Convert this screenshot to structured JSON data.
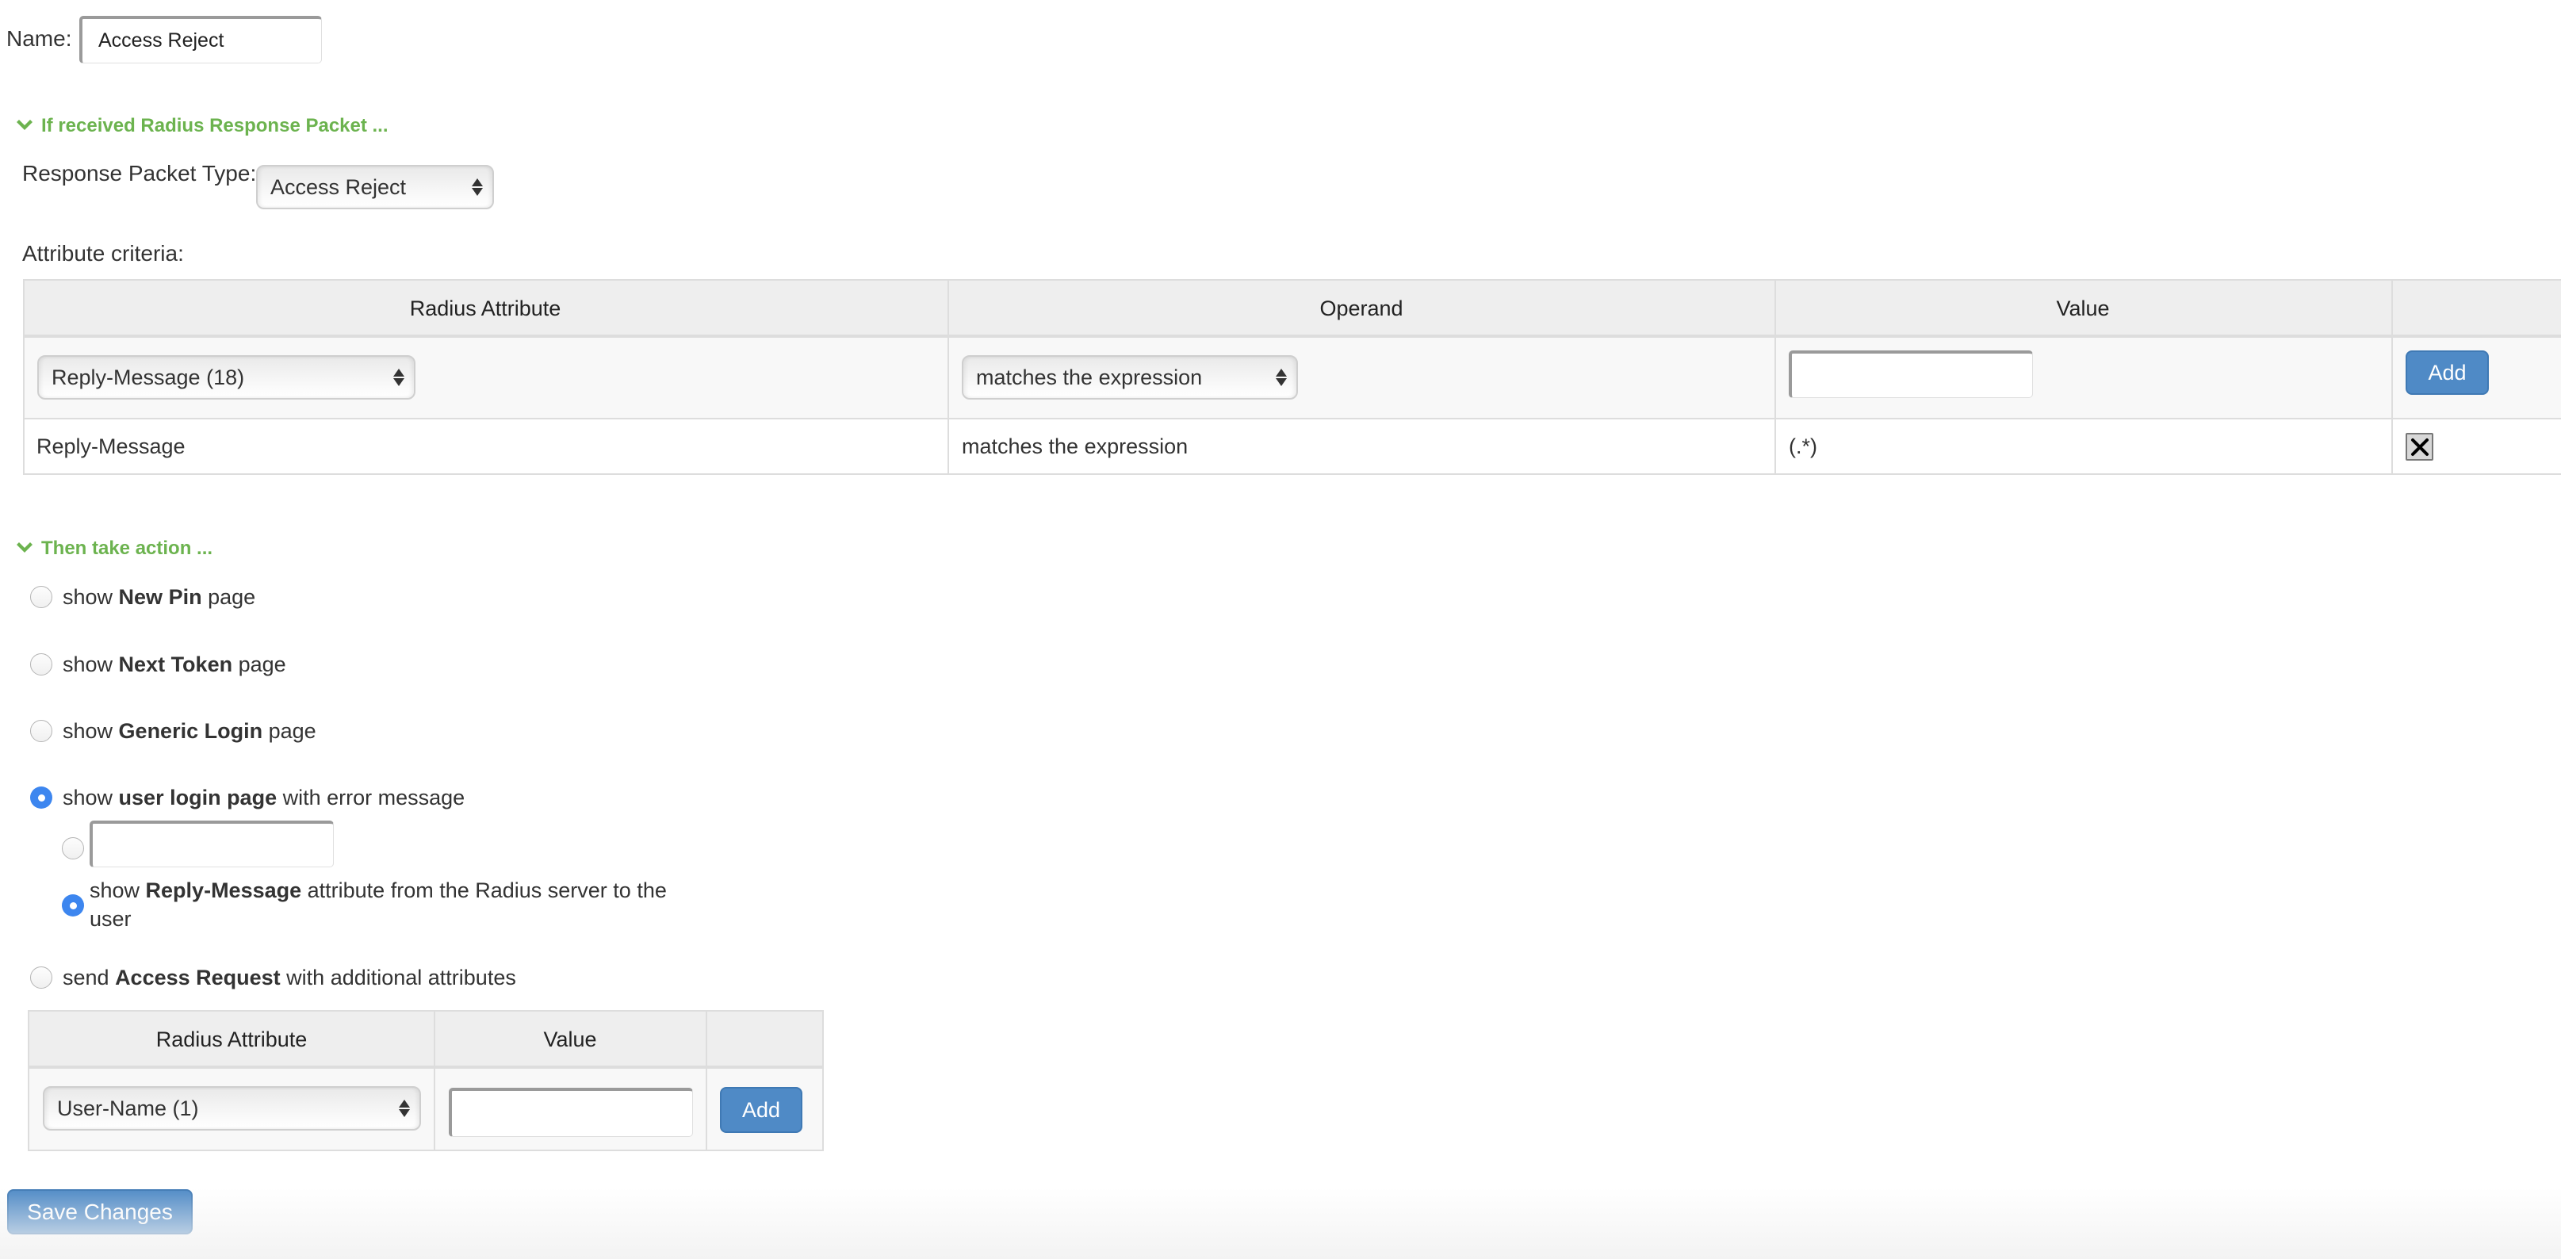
{
  "name_field": {
    "label": "Name:",
    "value": "Access Reject"
  },
  "response_section": {
    "heading": "If received Radius Response Packet ...",
    "packet_type_label": "Response Packet Type:",
    "packet_type_selected": "Access Reject",
    "criteria_label": "Attribute criteria:",
    "table": {
      "headers": [
        "Radius Attribute",
        "Operand",
        "Value",
        ""
      ],
      "new_row": {
        "attribute_selected": "Reply-Message (18)",
        "operand_selected": "matches the expression",
        "value": "",
        "add_label": "Add"
      },
      "rows": [
        {
          "attribute": "Reply-Message",
          "operand": "matches the expression",
          "value": "(.*)",
          "delete_icon": "close-icon"
        }
      ]
    }
  },
  "action_section": {
    "heading": "Then take action ...",
    "options": [
      {
        "pre": "show ",
        "bold": "New Pin",
        "post": " page",
        "selected": false
      },
      {
        "pre": "show ",
        "bold": "Next Token",
        "post": " page",
        "selected": false
      },
      {
        "pre": "show ",
        "bold": "Generic Login",
        "post": " page",
        "selected": false
      },
      {
        "pre": "show ",
        "bold": "user login page",
        "post": " with error message",
        "selected": true
      },
      {
        "pre": "send ",
        "bold": "Access Request",
        "post": " with additional attributes",
        "selected": false
      }
    ],
    "error_message_suboptions": {
      "custom_message": {
        "value": "",
        "selected": false
      },
      "reply_message": {
        "pre": "show ",
        "bold": "Reply-Message",
        "post_line1": " attribute from the Radius server to the",
        "post_line2": "user",
        "selected": true
      }
    },
    "access_request_table": {
      "headers": [
        "Radius Attribute",
        "Value",
        ""
      ],
      "new_row": {
        "attribute_selected": "User-Name (1)",
        "value": "",
        "add_label": "Add"
      }
    }
  },
  "save_button": {
    "label": "Save Changes"
  },
  "colors": {
    "section_heading": "#6cb34f",
    "primary_button": "#4f8ac6",
    "radio_selected": "#3d86ef"
  }
}
